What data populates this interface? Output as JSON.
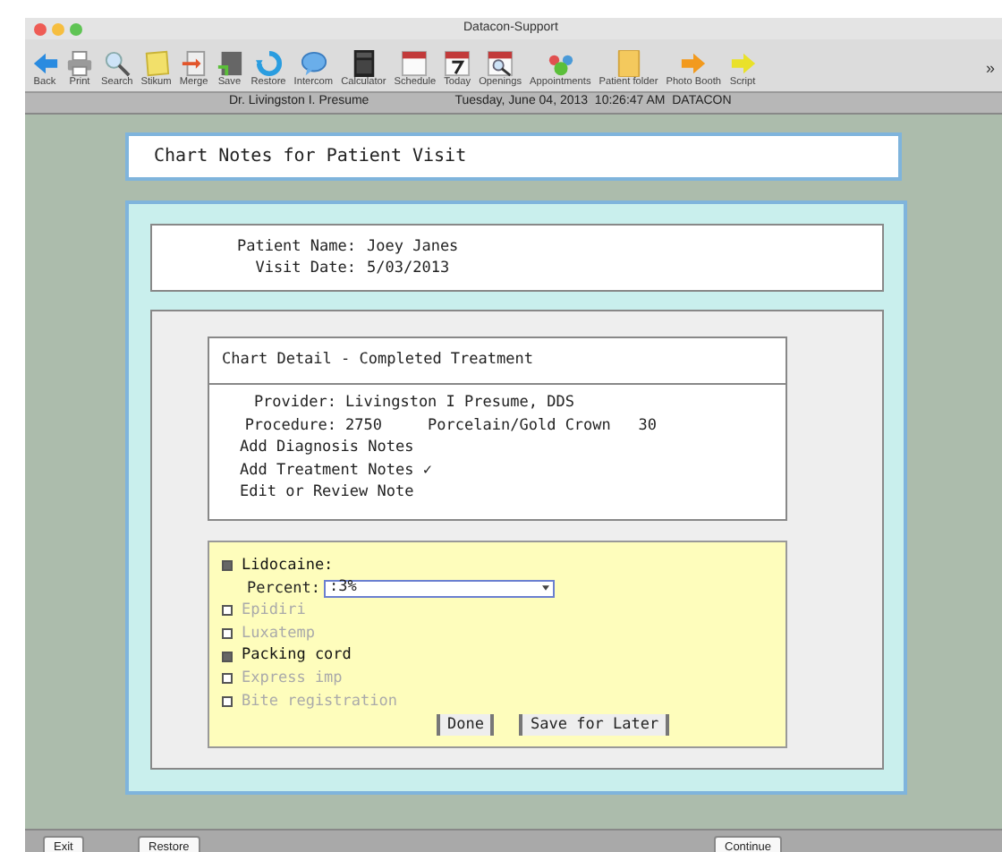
{
  "window": {
    "title": "Datacon-Support"
  },
  "toolbar": [
    "Back",
    "Print",
    "Search",
    "Stikum",
    "Merge",
    "Save",
    "Restore",
    "Intercom",
    "Calculator",
    "Schedule",
    "Today",
    "Openings",
    "Appointments",
    "Patient folder",
    "Photo Booth",
    "Script"
  ],
  "toolbar_overflow": "»",
  "status_bar": {
    "doctor": "Dr. Livingston I. Presume",
    "datetime": "Tuesday, June 04, 2013  10:26:47 AM  DATACON"
  },
  "header": {
    "title": "Chart Notes for Patient Visit"
  },
  "patient": [
    {
      "label": "Patient Name:",
      "value": "Joey Janes"
    },
    {
      "label": "Visit Date:",
      "value": "5/03/2013"
    }
  ],
  "chart_detail": {
    "title": "Chart Detail - Completed Treatment",
    "fields": [
      {
        "label": "Provider:",
        "value": "Livingston I Presume, DDS"
      },
      {
        "label": "Procedure:",
        "value": "2750     Porcelain/Gold Crown   30"
      }
    ],
    "links": [
      "Add Diagnosis Notes",
      "Add Treatment Notes ✓",
      "Edit or Review Note"
    ]
  },
  "materials": [
    {
      "label": "Lidocaine:",
      "checked": true,
      "disabled": false,
      "field": {
        "label": "Percent:",
        "value": ":3%"
      }
    },
    {
      "label": "Epidiri",
      "checked": false,
      "disabled": true
    },
    {
      "label": "Luxatemp",
      "checked": false,
      "disabled": true
    },
    {
      "label": "Packing cord",
      "checked": true,
      "disabled": false
    },
    {
      "label": "Express imp",
      "checked": false,
      "disabled": true
    },
    {
      "label": "Bite registration",
      "checked": false,
      "disabled": true
    }
  ],
  "material_buttons": [
    "Done",
    "Save for Later"
  ],
  "bottom_buttons": [
    "Exit",
    "Restore",
    "Continue"
  ]
}
